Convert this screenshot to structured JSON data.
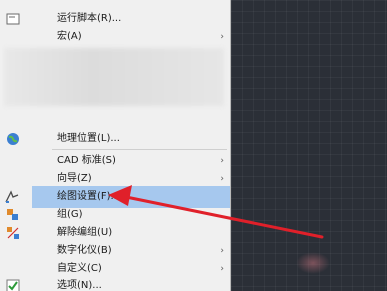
{
  "menu": {
    "items": [
      {
        "label": "运行脚本(R)...",
        "submenu": false,
        "icon": "script-icon"
      },
      {
        "label": "宏(A)",
        "submenu": true,
        "icon": ""
      },
      {
        "label": "地理位置(L)...",
        "submenu": false,
        "icon": "globe-icon"
      },
      {
        "label": "CAD 标准(S)",
        "submenu": true,
        "icon": ""
      },
      {
        "label": "向导(Z)",
        "submenu": true,
        "icon": ""
      },
      {
        "label": "绘图设置(F)...",
        "submenu": false,
        "icon": "drafting-settings-icon",
        "highlighted": true
      },
      {
        "label": "组(G)",
        "submenu": false,
        "icon": "group-icon"
      },
      {
        "label": "解除编组(U)",
        "submenu": false,
        "icon": "ungroup-icon"
      },
      {
        "label": "数字化仪(B)",
        "submenu": true,
        "icon": ""
      },
      {
        "label": "自定义(C)",
        "submenu": true,
        "icon": ""
      },
      {
        "label": "选项(N)...",
        "submenu": false,
        "icon": "checkbox-icon"
      }
    ],
    "submenu_arrow": "›"
  },
  "colors": {
    "menu_bg": "#f0f0f0",
    "highlight": "#a6c8ee",
    "canvas_bg": "#2b2f37",
    "annotation_arrow": "#e0202a"
  }
}
